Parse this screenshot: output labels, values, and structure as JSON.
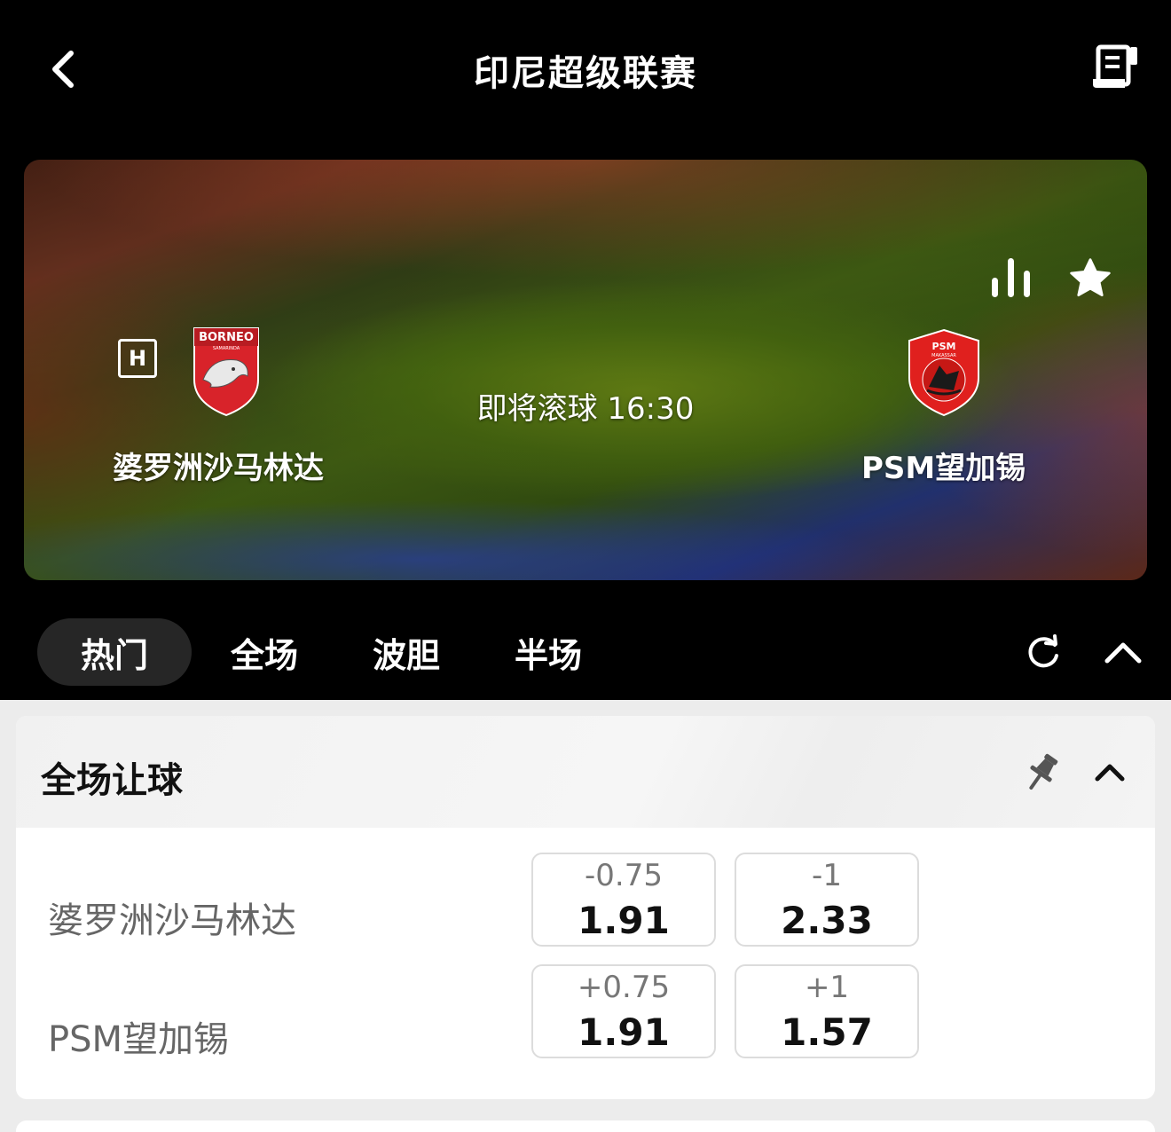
{
  "header": {
    "title": "印尼超级联赛",
    "back_icon": "chevron-left-icon",
    "betslip_icon": "receipt-icon"
  },
  "match": {
    "home_badge": "H",
    "home_team": "婆罗洲沙马林达",
    "away_team": "PSM望加锡",
    "kickoff": "即将滚球 16:30",
    "home_logo_text": "BORNEO",
    "home_logo_subtext": "SAMARINDA",
    "away_logo_text": "PSM",
    "away_logo_subtext": "MAKASSAR"
  },
  "tabs": [
    {
      "label": "热门",
      "active": true
    },
    {
      "label": "全场",
      "active": false
    },
    {
      "label": "波胆",
      "active": false
    },
    {
      "label": "半场",
      "active": false
    }
  ],
  "market": {
    "title": "全场让球",
    "rows": [
      {
        "team": "婆罗洲沙马林达",
        "odds": [
          {
            "line": "-0.75",
            "price": "1.91"
          },
          {
            "line": "-1",
            "price": "2.33"
          }
        ]
      },
      {
        "team": "PSM望加锡",
        "odds": [
          {
            "line": "+0.75",
            "price": "1.91"
          },
          {
            "line": "+1",
            "price": "1.57"
          }
        ]
      }
    ]
  },
  "colors": {
    "background": "#000000",
    "active_tab": "#262626",
    "content_bg": "#ececec",
    "home_logo_red": "#d8232a",
    "away_logo_red": "#e0201e"
  }
}
